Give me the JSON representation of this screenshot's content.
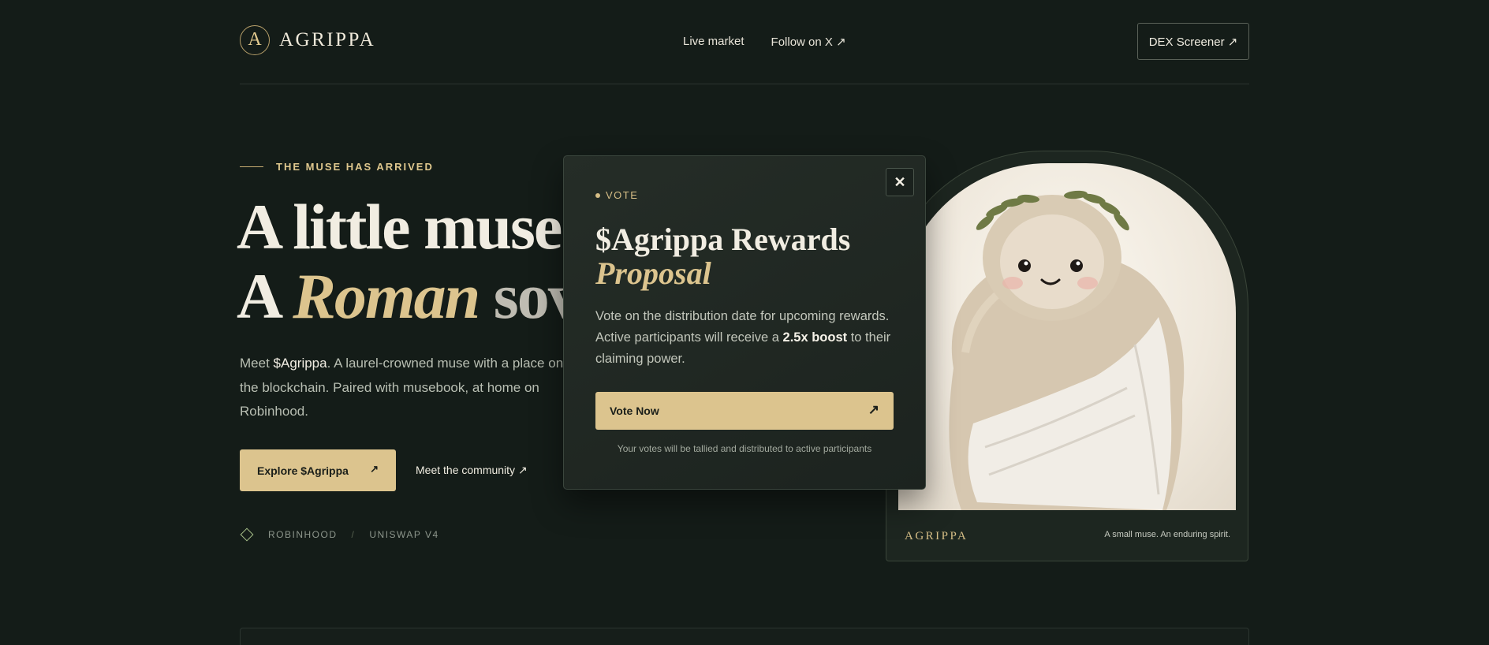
{
  "header": {
    "logo_letter": "A",
    "brand": "AGRIPPA",
    "nav": [
      "Live market",
      "Follow on X ↗"
    ],
    "dex_button": "DEX Screener ↗"
  },
  "hero": {
    "eyebrow": "THE MUSE HAS ARRIVED",
    "headline_line1": "A little muse",
    "headline_line2_a": "A ",
    "headline_line2_em": "Roman",
    "headline_line2_b": " sov",
    "lead_prefix": "Meet ",
    "lead_highlight": "$Agrippa",
    "lead_rest": ". A laurel-crowned muse with a place on the blockchain. Paired with musebook, at home on Robinhood.",
    "cta_primary": "Explore $Agrippa",
    "cta_primary_arrow": "↗",
    "cta_secondary": "Meet the community ↗",
    "platforms": [
      "ROBINHOOD",
      "UNISWAP V4"
    ],
    "platform_separator": "/"
  },
  "card": {
    "brand": "AGRIPPA",
    "tagline": "A small muse. An enduring spirit."
  },
  "modal": {
    "close": "✕",
    "tag": "VOTE",
    "title": "$Agrippa Rewards",
    "title_em": "Proposal",
    "body_prefix": "Vote on the distribution date for upcoming rewards. Active participants will receive a ",
    "body_bold": "2.5x boost",
    "body_suffix": " to their claiming power.",
    "button": "Vote Now",
    "button_arrow": "↗",
    "note": "Your votes will be tallied and distributed to active participants"
  },
  "colors": {
    "background": "#141c18",
    "accent_gold": "#dcc48e",
    "card_bg": "#1d2620"
  },
  "icons": [
    "logo-mark-icon",
    "arrow-up-right-icon",
    "close-icon",
    "diamond-icon"
  ]
}
